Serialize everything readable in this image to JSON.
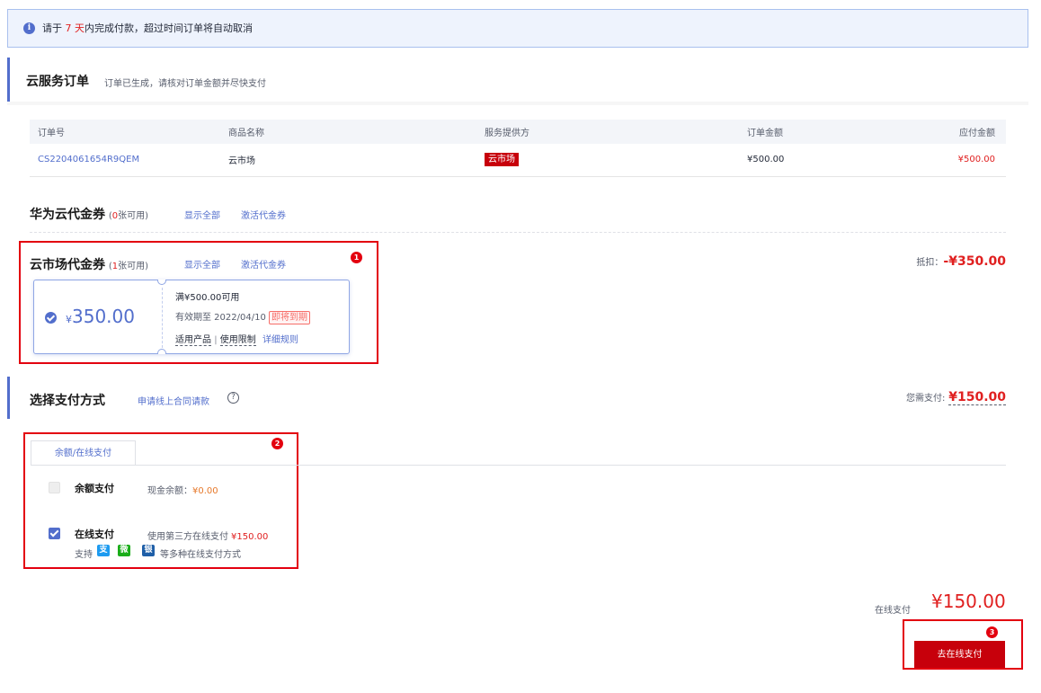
{
  "notice": {
    "prefix": "请于",
    "days": "7 天",
    "suffix": "内完成付款，超过时间订单将自动取消"
  },
  "order_section": {
    "title": "云服务订单",
    "subtitle": "订单已生成，请核对订单金额并尽快支付",
    "columns": [
      "订单号",
      "商品名称",
      "服务提供方",
      "订单金额",
      "应付金额"
    ],
    "rows": [
      {
        "order_id": "CS2204061654R9QEM",
        "product": "云市场",
        "provider": "云市场",
        "amount": "¥500.00",
        "payable": "¥500.00"
      }
    ]
  },
  "huawei_coupons": {
    "title": "华为云代金券",
    "count_prefix": "(",
    "count_num": "0",
    "count_suffix": "张可用)",
    "show_all": "显示全部",
    "activate": "激活代金券"
  },
  "market_coupons": {
    "title": "云市场代金券",
    "count_prefix": "(",
    "count_num": "1",
    "count_suffix": "张可用)",
    "show_all": "显示全部",
    "activate": "激活代金券",
    "deduction_label": "抵扣：",
    "deduction_value": "-¥350.00",
    "badge": "1",
    "card": {
      "currency": "¥",
      "amount": "350.00",
      "condition": "满¥500.00可用",
      "expiry_label": "有效期至 2022/04/10",
      "expiring_tag": "即将到期",
      "applicable": "适用产品",
      "separator": "|",
      "limits": "使用限制",
      "rules": "详细规则"
    }
  },
  "payment": {
    "title": "选择支付方式",
    "contract_link": "申请线上合同请款",
    "due_label": "您需支付:",
    "due_value": "¥150.00",
    "badge": "2",
    "tab": "余额/在线支付",
    "balance": {
      "name": "余额支付",
      "desc_label": "现金余额：",
      "desc_value": "¥0.00",
      "checked": false
    },
    "online": {
      "name": "在线支付",
      "desc_label": "使用第三方在线支付",
      "desc_value": "¥150.00",
      "support": "支持",
      "support_suffix": "等多种在线支付方式",
      "checked": true
    },
    "logos": [
      {
        "name": "alipay-logo",
        "glyph": "支",
        "color": "#1d9bf0"
      },
      {
        "name": "wechat-logo",
        "glyph": "微",
        "color": "#1aad19"
      },
      {
        "name": "unionpay-logo",
        "glyph": "银",
        "color": "#1f5fa8"
      }
    ]
  },
  "footer": {
    "total_label": "在线支付",
    "total_value": "¥150.00",
    "badge": "3",
    "pay_button": "去在线支付"
  }
}
